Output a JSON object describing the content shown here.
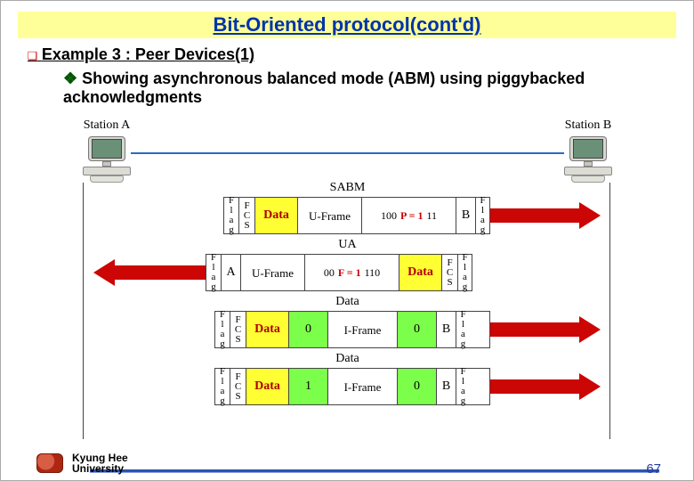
{
  "title": "Bit-Oriented protocol(cont'd)",
  "example": {
    "bullet": "❑",
    "text": "Example 3 : Peer Devices(1)"
  },
  "sub": {
    "bullet": "❖",
    "text": " Showing asynchronous balanced mode (ABM) using piggybacked acknowledgments"
  },
  "stations": {
    "a": "Station A",
    "b": "Station B"
  },
  "flag_chars": [
    "F",
    "l",
    "a",
    "g"
  ],
  "fcs_chars": [
    "F",
    "C",
    "S"
  ],
  "rows": [
    {
      "caption": "SABM",
      "dir": "right",
      "cells": {
        "addr": "B",
        "data": "Data",
        "uframe": "U-Frame",
        "bits_left": "100",
        "pf": "P = 1",
        "bits_right": "11"
      }
    },
    {
      "caption": "UA",
      "dir": "left",
      "cells": {
        "addr": "A",
        "data": "Data",
        "uframe": "U-Frame",
        "bits_left": "00",
        "pf": "F = 1",
        "bits_right": "110"
      }
    },
    {
      "caption": "Data",
      "dir": "right",
      "cells": {
        "addr": "B",
        "data": "Data",
        "iframe": "I-Frame",
        "num1": "0",
        "num2": "0"
      }
    },
    {
      "caption": "Data",
      "dir": "right",
      "cells": {
        "addr": "B",
        "data": "Data",
        "iframe": "I-Frame",
        "num1": "1",
        "num2": "0"
      }
    }
  ],
  "footer": {
    "uni1": "Kyung Hee",
    "uni2": "University",
    "page": "67"
  },
  "chart_data": {
    "type": "table",
    "title": "HDLC ABM example – frame exchange between Station A and Station B",
    "rows": [
      {
        "direction": "A→B",
        "label": "SABM",
        "frame_type": "U-Frame",
        "fields": [
          "Flag",
          "FCS",
          "Data",
          "U-Frame",
          "100 P=1 11",
          "B",
          "Flag"
        ]
      },
      {
        "direction": "B→A",
        "label": "UA",
        "frame_type": "U-Frame",
        "fields": [
          "Flag",
          "A",
          "U-Frame",
          "00 F=1 110",
          "Data",
          "FCS",
          "Flag"
        ]
      },
      {
        "direction": "A→B",
        "label": "Data",
        "frame_type": "I-Frame",
        "fields": [
          "Flag",
          "FCS",
          "Data",
          "0",
          "I-Frame",
          "0",
          "B",
          "Flag"
        ]
      },
      {
        "direction": "A→B",
        "label": "Data",
        "frame_type": "I-Frame",
        "fields": [
          "Flag",
          "FCS",
          "Data",
          "1",
          "I-Frame",
          "0",
          "B",
          "Flag"
        ]
      }
    ]
  }
}
